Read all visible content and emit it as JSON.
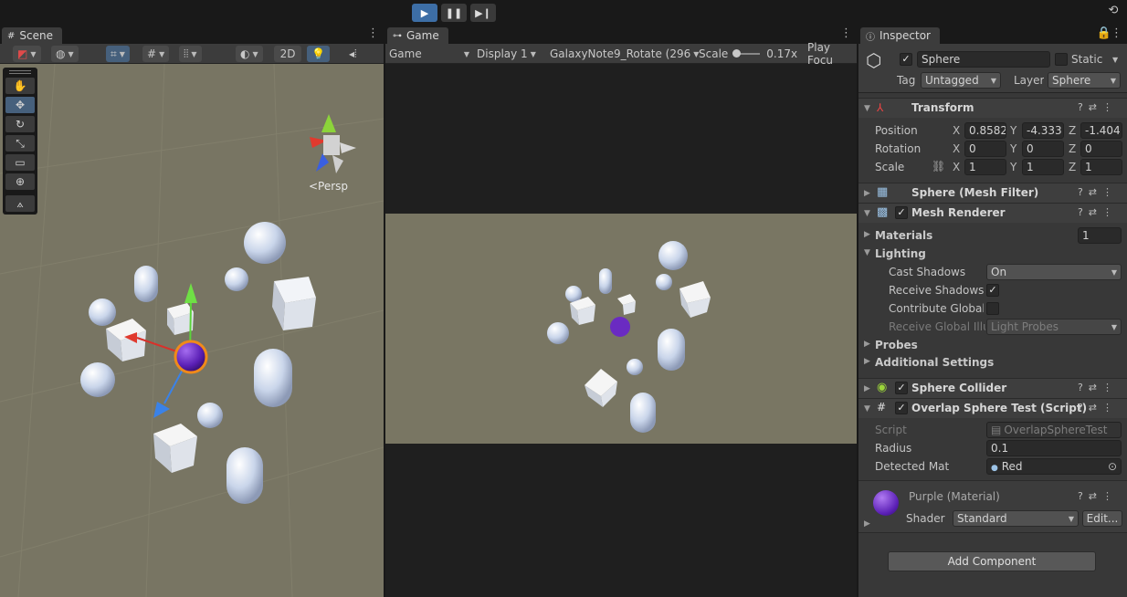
{
  "playbar": {
    "play_icon": "play-icon",
    "pause_icon": "pause-icon",
    "step_icon": "step-icon",
    "history_icon": "history-icon"
  },
  "scene": {
    "tab": "Scene",
    "toolbar": {
      "twod": "2D"
    },
    "persp": "<Persp"
  },
  "game": {
    "tab": "Game",
    "toolbar": {
      "mode": "Game",
      "display": "Display 1",
      "resolution": "GalaxyNote9_Rotate (296",
      "scale_label": "Scale",
      "scale_value": "0.17x",
      "play_focus": "Play Focu"
    }
  },
  "inspector": {
    "tab": "Inspector",
    "object": {
      "name": "Sphere",
      "static_label": "Static",
      "tag_label": "Tag",
      "tag_value": "Untagged",
      "layer_label": "Layer",
      "layer_value": "Sphere"
    },
    "transform": {
      "title": "Transform",
      "position_label": "Position",
      "rotation_label": "Rotation",
      "scale_label": "Scale",
      "position": {
        "x": "0.8582",
        "y": "-4.333",
        "z": "-1.404"
      },
      "rotation": {
        "x": "0",
        "y": "0",
        "z": "0"
      },
      "scale": {
        "x": "1",
        "y": "1",
        "z": "1"
      },
      "axis_x": "X",
      "axis_y": "Y",
      "axis_z": "Z"
    },
    "mesh_filter": {
      "title": "Sphere (Mesh Filter)"
    },
    "mesh_renderer": {
      "title": "Mesh Renderer",
      "materials_label": "Materials",
      "materials_count": "1",
      "lighting_label": "Lighting",
      "cast_shadows_label": "Cast Shadows",
      "cast_shadows_value": "On",
      "receive_shadows_label": "Receive Shadows",
      "contribute_gi_label": "Contribute Global I",
      "receive_gi_label": "Receive Global Illu",
      "receive_gi_value": "Light Probes",
      "probes_label": "Probes",
      "additional_label": "Additional Settings"
    },
    "sphere_collider": {
      "title": "Sphere Collider"
    },
    "overlap_script": {
      "title": "Overlap Sphere Test (Script)",
      "script_label": "Script",
      "script_value": "OverlapSphereTest",
      "radius_label": "Radius",
      "radius_value": "0.1",
      "detected_label": "Detected Mat",
      "detected_value": "Red"
    },
    "material": {
      "title": "Purple (Material)",
      "shader_label": "Shader",
      "shader_value": "Standard",
      "edit_label": "Edit..."
    },
    "add_component": "Add Component"
  },
  "colors": {
    "accent": "#3d6ea6",
    "scene_bg": "#787563",
    "purple": "#6a2bc2",
    "red": "#d9302a"
  }
}
